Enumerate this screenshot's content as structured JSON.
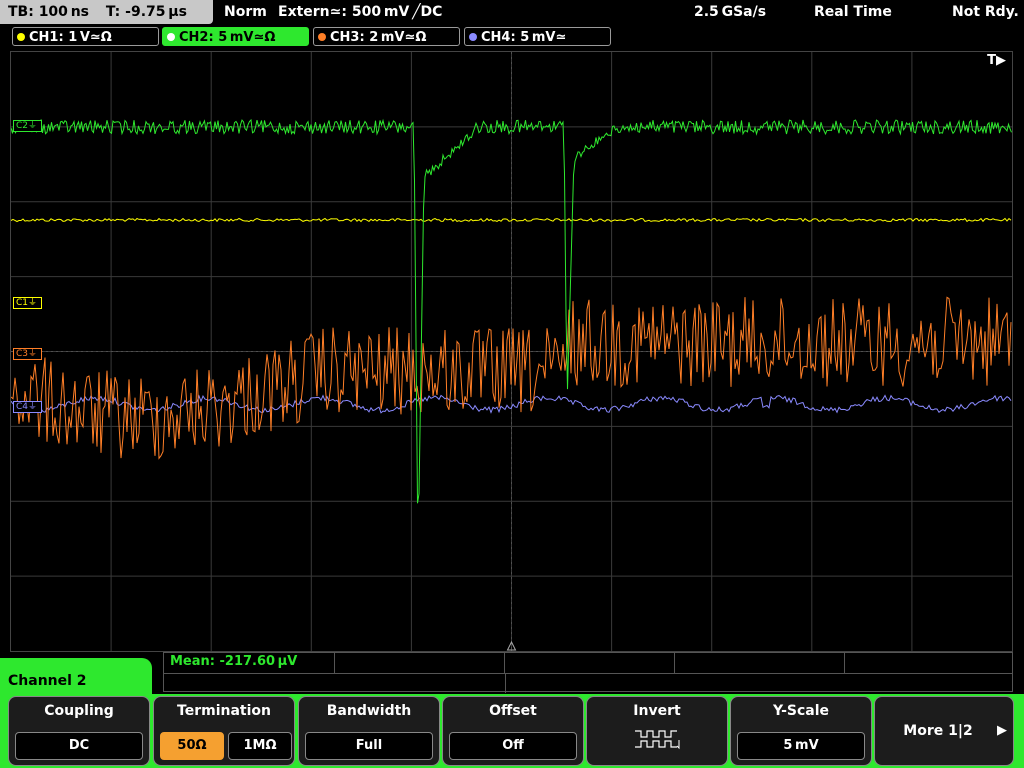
{
  "header": {
    "timebase": "TB: 100 ns",
    "trigger_time": "T: -9.75 µs",
    "mode": "Norm",
    "trigger_source": "Extern≃: 500 mV ╱DC",
    "sample_rate": "2.5 GSa/s",
    "acq_mode": "Real Time",
    "status": "Not Rdy."
  },
  "channels": [
    {
      "label": "CH1: 1 V≃Ω",
      "color": "#ffff00",
      "active": false
    },
    {
      "label": "CH2: 5 mV≃Ω",
      "color": "#2ee82e",
      "active": true
    },
    {
      "label": "CH3: 2 mV≃Ω",
      "color": "#ff7f27",
      "active": false
    },
    {
      "label": "CH4: 5 mV≃",
      "color": "#8a8aff",
      "active": false
    }
  ],
  "markers": {
    "c1": "C1⏚",
    "c2": "C2⏚",
    "c3": "C3⏚",
    "c4": "C4⏚"
  },
  "trigger_indicator": "T▶",
  "measurement": {
    "mean": "Mean: -217.60 µV"
  },
  "panel": {
    "title": "Channel 2",
    "softkeys": [
      {
        "title": "Coupling",
        "value": "DC"
      },
      {
        "title": "Termination",
        "value_a": "50Ω",
        "value_b": "1MΩ"
      },
      {
        "title": "Bandwidth",
        "value": "Full"
      },
      {
        "title": "Offset",
        "value": "Off"
      },
      {
        "title": "Invert",
        "icon": "invert-waveform-icon"
      },
      {
        "title": "Y-Scale",
        "value": "5 mV"
      },
      {
        "title": "More 1|2",
        "icon": "right-arrow-icon"
      }
    ]
  },
  "colors": {
    "ch1": "#ffff00",
    "ch2": "#2ee82e",
    "ch3": "#ff7f27",
    "ch4": "#8a8aff",
    "accent": "#2ee82e",
    "selected": "#f5a030"
  }
}
